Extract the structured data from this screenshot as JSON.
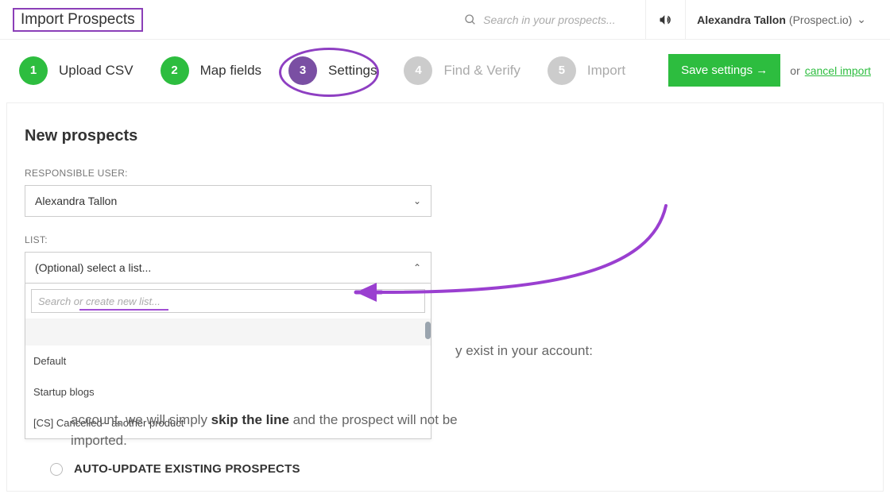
{
  "header": {
    "title": "Import Prospects",
    "search_placeholder": "Search in your prospects...",
    "user_name": "Alexandra Tallon",
    "user_org": "(Prospect.io)"
  },
  "steps": [
    {
      "num": "1",
      "label": "Upload CSV",
      "state": "done"
    },
    {
      "num": "2",
      "label": "Map fields",
      "state": "done"
    },
    {
      "num": "3",
      "label": "Settings",
      "state": "current"
    },
    {
      "num": "4",
      "label": "Find & Verify",
      "state": "future"
    },
    {
      "num": "5",
      "label": "Import",
      "state": "future"
    }
  ],
  "actions": {
    "save_label": "Save settings →",
    "or_text": "or",
    "cancel_label": "cancel import"
  },
  "form": {
    "section_title": "New prospects",
    "responsible_label": "RESPONSIBLE USER:",
    "responsible_value": "Alexandra Tallon",
    "list_label": "LIST:",
    "list_placeholder": "(Optional) select a list...",
    "list_search_placeholder": "Search or create new list...",
    "list_options": [
      "Default",
      "Startup blogs",
      "[CS] Cancelled - another product"
    ]
  },
  "copy": {
    "behind_fragment": "y exist in your account:",
    "skip_part1": "account, we will simply ",
    "skip_bold": "skip the line",
    "skip_part2": " and the prospect will not be imported.",
    "auto_update_label": "AUTO-UPDATE EXISTING PROSPECTS"
  }
}
